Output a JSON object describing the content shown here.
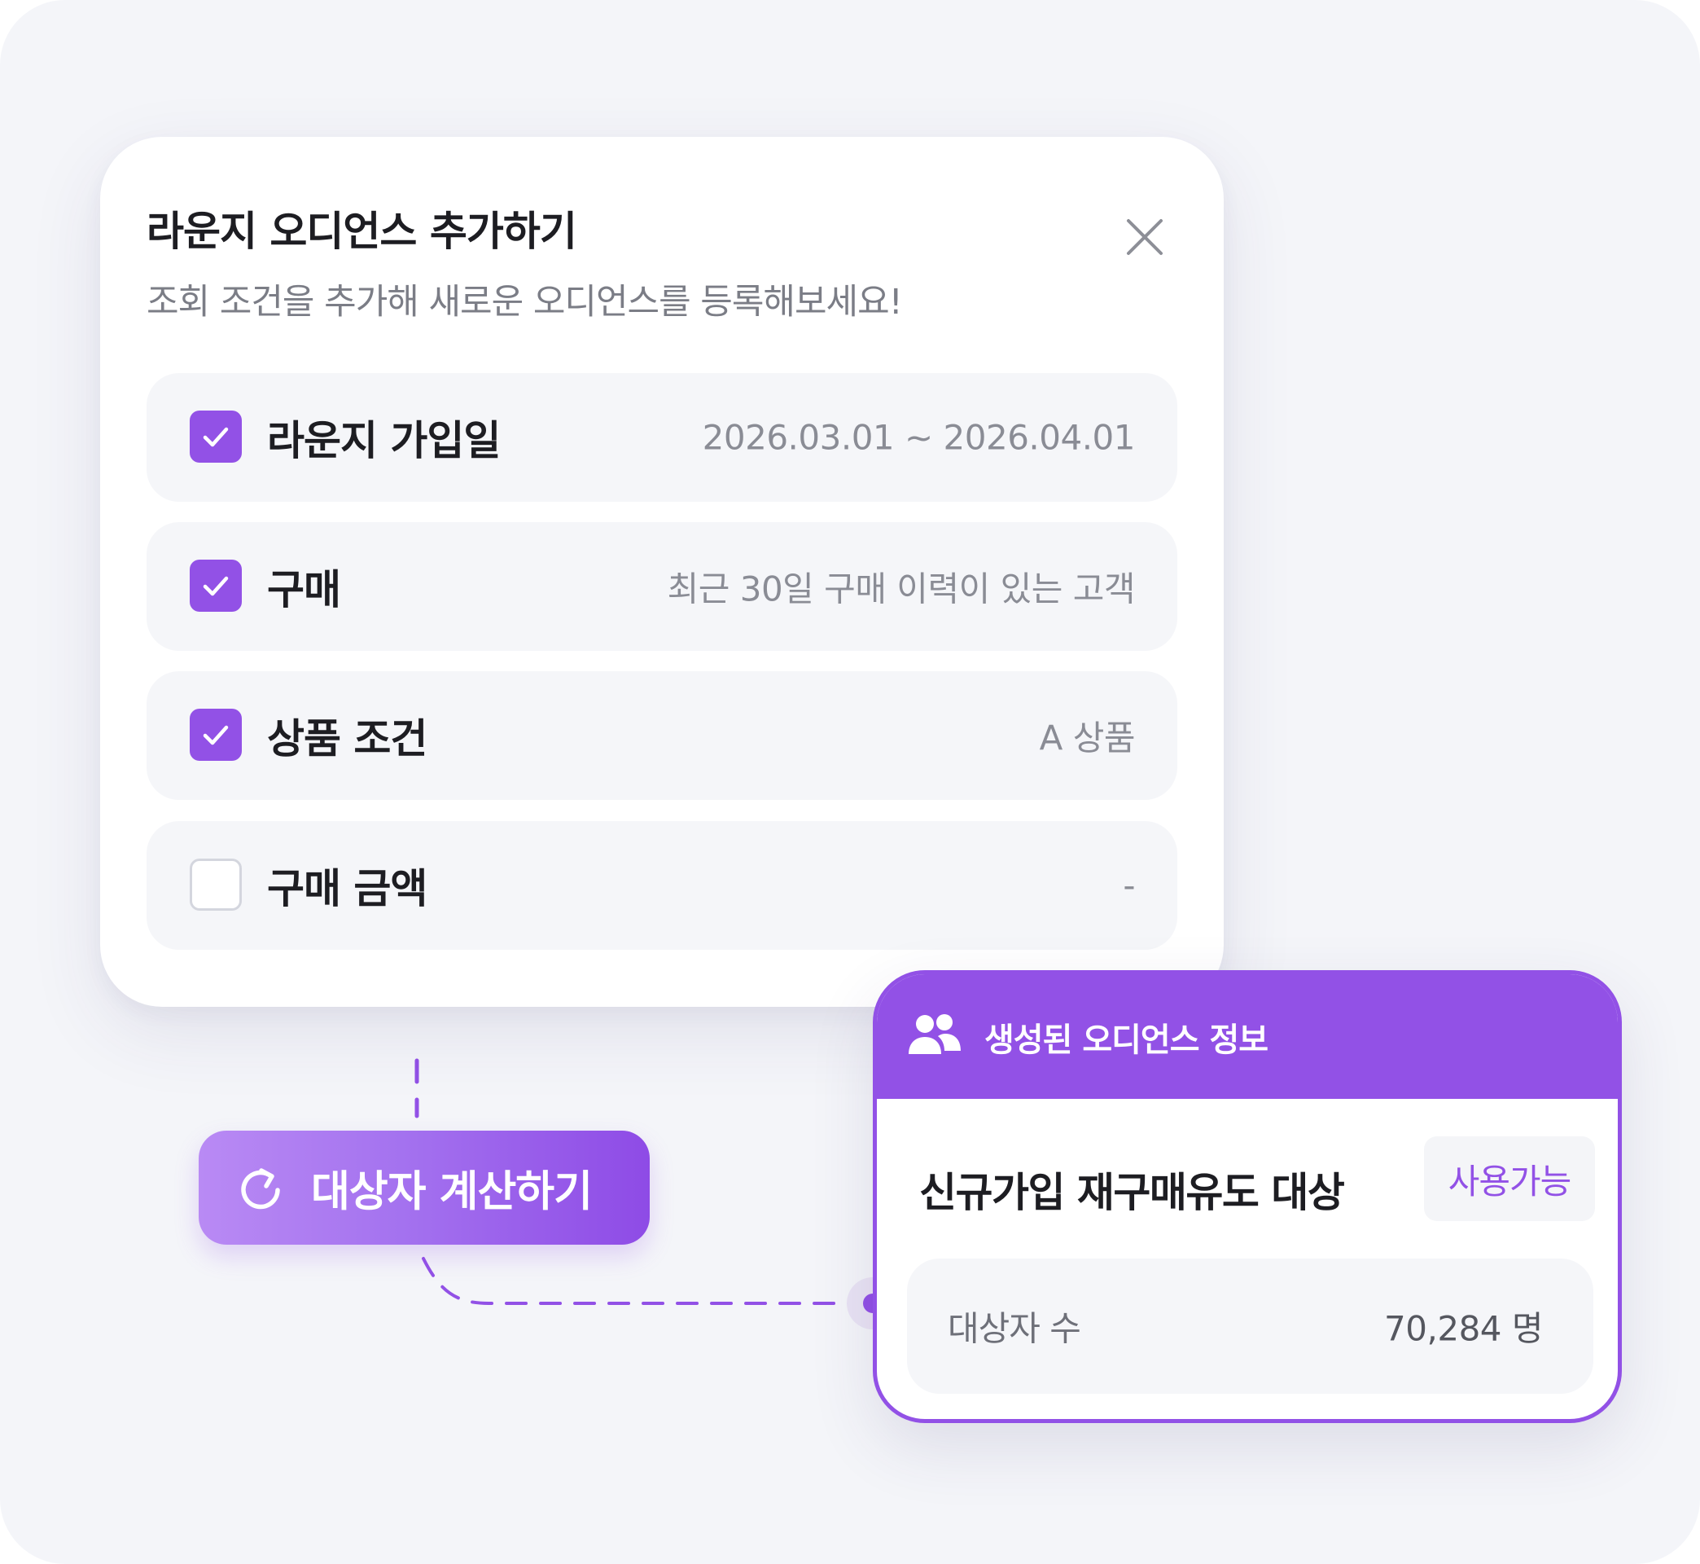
{
  "modal": {
    "title": "라운지 오디언스 추가하기",
    "subtitle": "조회 조건을 추가해 새로운 오디언스를 등록해보세요!",
    "close_icon": "close-icon",
    "conditions": [
      {
        "label": "라운지 가입일",
        "value": "2026.03.01 ~ 2026.04.01",
        "checked": true
      },
      {
        "label": "구매",
        "value": "최근 30일 구매 이력이 있는 고객",
        "checked": true
      },
      {
        "label": "상품 조건",
        "value": "A 상품",
        "checked": true
      },
      {
        "label": "구매 금액",
        "value": "-",
        "checked": false
      }
    ]
  },
  "calculate_button": {
    "label": "대상자 계산하기",
    "icon": "refresh-icon"
  },
  "result_card": {
    "header_icon": "people-icon",
    "header_title": "생성된 오디언스 정보",
    "audience_name": "신규가입 재구매유도 대상",
    "status": "사용가능",
    "count_label": "대상자 수",
    "count_value": "70,284 명"
  },
  "colors": {
    "accent": "#9251e6",
    "background": "#f4f5f9",
    "card": "#ffffff",
    "row_background": "#f5f6f9"
  }
}
